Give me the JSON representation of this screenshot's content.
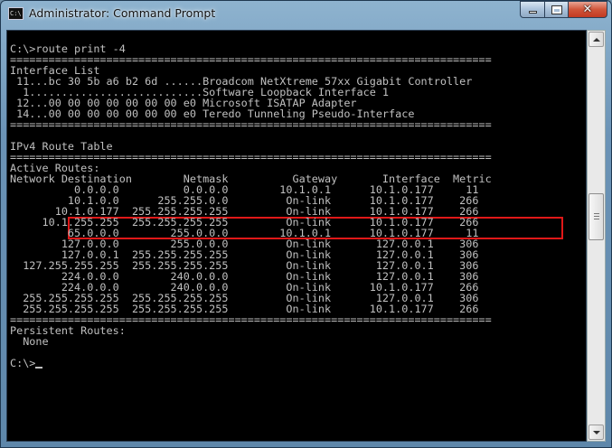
{
  "window": {
    "title": "Administrator: Command Prompt",
    "icon_text": "C:\\"
  },
  "console": {
    "lines": [
      "",
      "C:\\>route print -4",
      "===========================================================================",
      "Interface List",
      " 11...bc 30 5b a6 b2 6d ......Broadcom NetXtreme 57xx Gigabit Controller",
      "  1...........................Software Loopback Interface 1",
      " 12...00 00 00 00 00 00 00 e0 Microsoft ISATAP Adapter",
      " 14...00 00 00 00 00 00 00 e0 Teredo Tunneling Pseudo-Interface",
      "===========================================================================",
      "",
      "IPv4 Route Table",
      "===========================================================================",
      "Active Routes:",
      "Network Destination        Netmask          Gateway       Interface  Metric",
      "          0.0.0.0          0.0.0.0        10.1.0.1      10.1.0.177     11",
      "         10.1.0.0      255.255.0.0         On-link      10.1.0.177    266",
      "       10.1.0.177  255.255.255.255         On-link      10.1.0.177    266",
      "     10.1.255.255  255.255.255.255         On-link      10.1.0.177    266",
      "         65.0.0.0        255.0.0.0        10.1.0.1      10.1.0.177     11",
      "        127.0.0.0        255.0.0.0         On-link       127.0.0.1    306",
      "        127.0.0.1  255.255.255.255         On-link       127.0.0.1    306",
      "  127.255.255.255  255.255.255.255         On-link       127.0.0.1    306",
      "        224.0.0.0        240.0.0.0         On-link       127.0.0.1    306",
      "        224.0.0.0        240.0.0.0         On-link      10.1.0.177    266",
      "  255.255.255.255  255.255.255.255         On-link       127.0.0.1    306",
      "  255.255.255.255  255.255.255.255         On-link      10.1.0.177    266",
      "===========================================================================",
      "Persistent Routes:",
      "  None",
      "",
      "C:\\>"
    ]
  },
  "colors": {
    "console_bg": "#000000",
    "console_text": "#c0c0c0",
    "highlight_box": "#e01818"
  },
  "icons": {
    "minimize": "minimize-icon",
    "maximize": "maximize-icon",
    "close": "close-icon"
  }
}
